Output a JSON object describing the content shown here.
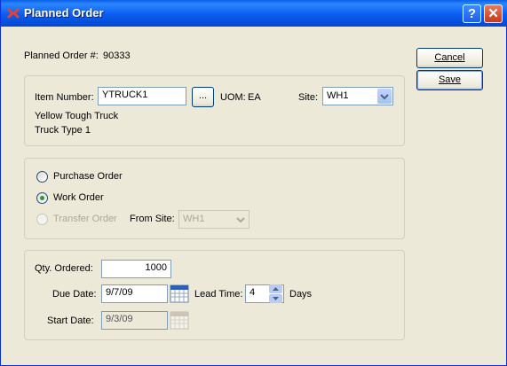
{
  "window": {
    "title": "Planned Order"
  },
  "header": {
    "order_label": "Planned Order #:",
    "order_number": "90333"
  },
  "buttons": {
    "cancel": "Cancel",
    "save": "Save",
    "item_lookup": "..."
  },
  "item": {
    "label": "Item Number:",
    "value": "YTRUCK1",
    "uom_label": "UOM:",
    "uom_value": "EA",
    "site_label": "Site:",
    "site_value": "WH1",
    "description1": "Yellow Tough Truck",
    "description2": "Truck Type 1"
  },
  "order_type": {
    "purchase": "Purchase Order",
    "work": "Work Order",
    "transfer": "Transfer Order",
    "from_site_label": "From Site:",
    "from_site_value": "WH1",
    "selected": "work"
  },
  "schedule": {
    "qty_label": "Qty. Ordered:",
    "qty_value": "1000",
    "due_label": "Due Date:",
    "due_value": "9/7/09",
    "lead_label": "Lead Time:",
    "lead_value": "4",
    "days_label": "Days",
    "start_label": "Start Date:",
    "start_value": "9/3/09"
  },
  "colors": {
    "accent": "#0a5cf1",
    "radio_selected": "#21a121",
    "face": "#ece9d8"
  }
}
